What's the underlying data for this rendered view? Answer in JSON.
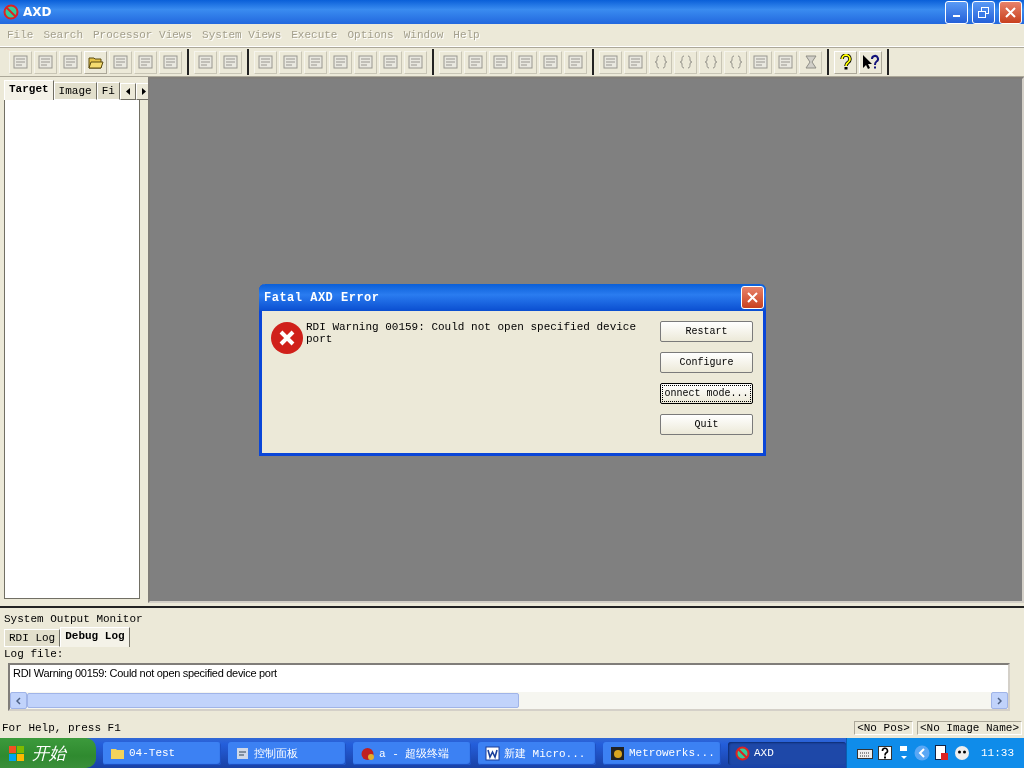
{
  "window": {
    "title": "AXD"
  },
  "menu": [
    {
      "label": "File",
      "disabled": true
    },
    {
      "label": "Search",
      "disabled": true
    },
    {
      "label": "Processor Views",
      "disabled": true
    },
    {
      "label": "System Views",
      "disabled": true
    },
    {
      "label": "Execute",
      "disabled": true
    },
    {
      "label": "Options",
      "disabled": true
    },
    {
      "label": "Window",
      "disabled": true
    },
    {
      "label": "Help",
      "disabled": true
    }
  ],
  "toolbar": [
    {
      "buttons": [
        {
          "kind": "doc",
          "disabled": true
        },
        {
          "kind": "doc",
          "disabled": true
        },
        {
          "kind": "doc",
          "disabled": true
        },
        {
          "kind": "folder",
          "disabled": false
        },
        {
          "kind": "doc",
          "disabled": true
        },
        {
          "kind": "doc",
          "disabled": true
        },
        {
          "kind": "doc",
          "disabled": true
        }
      ]
    },
    {
      "buttons": [
        {
          "kind": "doc",
          "disabled": true
        },
        {
          "kind": "doc",
          "disabled": true
        }
      ]
    },
    {
      "buttons": [
        {
          "kind": "doc",
          "disabled": true
        },
        {
          "kind": "doc",
          "disabled": true
        },
        {
          "kind": "doc",
          "disabled": true
        },
        {
          "kind": "doc",
          "disabled": true
        },
        {
          "kind": "doc",
          "disabled": true
        },
        {
          "kind": "doc",
          "disabled": true
        },
        {
          "kind": "doc",
          "disabled": true
        }
      ]
    },
    {
      "buttons": [
        {
          "kind": "doc",
          "disabled": true
        },
        {
          "kind": "doc",
          "disabled": true
        },
        {
          "kind": "doc",
          "disabled": true
        },
        {
          "kind": "doc",
          "disabled": true
        },
        {
          "kind": "doc",
          "disabled": true
        },
        {
          "kind": "doc",
          "disabled": true
        }
      ]
    },
    {
      "buttons": [
        {
          "kind": "doc",
          "disabled": true
        },
        {
          "kind": "doc",
          "disabled": true
        },
        {
          "kind": "brace",
          "disabled": true
        },
        {
          "kind": "brace",
          "disabled": true
        },
        {
          "kind": "brace",
          "disabled": true
        },
        {
          "kind": "brace",
          "disabled": true
        },
        {
          "kind": "doc",
          "disabled": true
        },
        {
          "kind": "doc",
          "disabled": true
        },
        {
          "kind": "hourglass",
          "disabled": true
        }
      ]
    },
    {
      "buttons": [
        {
          "kind": "help",
          "disabled": false
        },
        {
          "kind": "context-help",
          "disabled": false
        }
      ]
    }
  ],
  "side_panel": {
    "tabs": [
      {
        "label": "Target",
        "selected": true
      },
      {
        "label": "Image",
        "selected": false
      },
      {
        "label": "Fi",
        "selected": false
      }
    ]
  },
  "dialog": {
    "title": "Fatal AXD Error",
    "message": "RDI Warning 00159: Could not open specified device port",
    "buttons": [
      {
        "label": "Restart",
        "focused": false
      },
      {
        "label": "Configure",
        "focused": false
      },
      {
        "label": "onnect mode...",
        "focused": true
      },
      {
        "label": "Quit",
        "focused": false
      }
    ]
  },
  "output_monitor": {
    "title": "System Output Monitor",
    "tabs": [
      {
        "label": "RDI Log",
        "selected": false
      },
      {
        "label": "Debug Log",
        "selected": true
      }
    ],
    "log_label": "Log file:",
    "log_text": "RDI Warning 00159: Could not open specified device port"
  },
  "status_bar": {
    "help": "For Help, press F1",
    "position": "<No Pos>",
    "image_name": "<No Image Name>"
  },
  "taskbar": {
    "start": "开始",
    "tasks": [
      {
        "label": "04-Test",
        "kind": "folder",
        "selected": false
      },
      {
        "label": "控制面板",
        "kind": "panel",
        "selected": false
      },
      {
        "label": "a - 超级终端",
        "kind": "terminal",
        "selected": false
      },
      {
        "label": "新建 Micro...",
        "kind": "word",
        "selected": false
      },
      {
        "label": "Metrowerks...",
        "kind": "film",
        "selected": false
      },
      {
        "label": "AXD",
        "kind": "app",
        "selected": true
      }
    ],
    "time": "11:33"
  }
}
